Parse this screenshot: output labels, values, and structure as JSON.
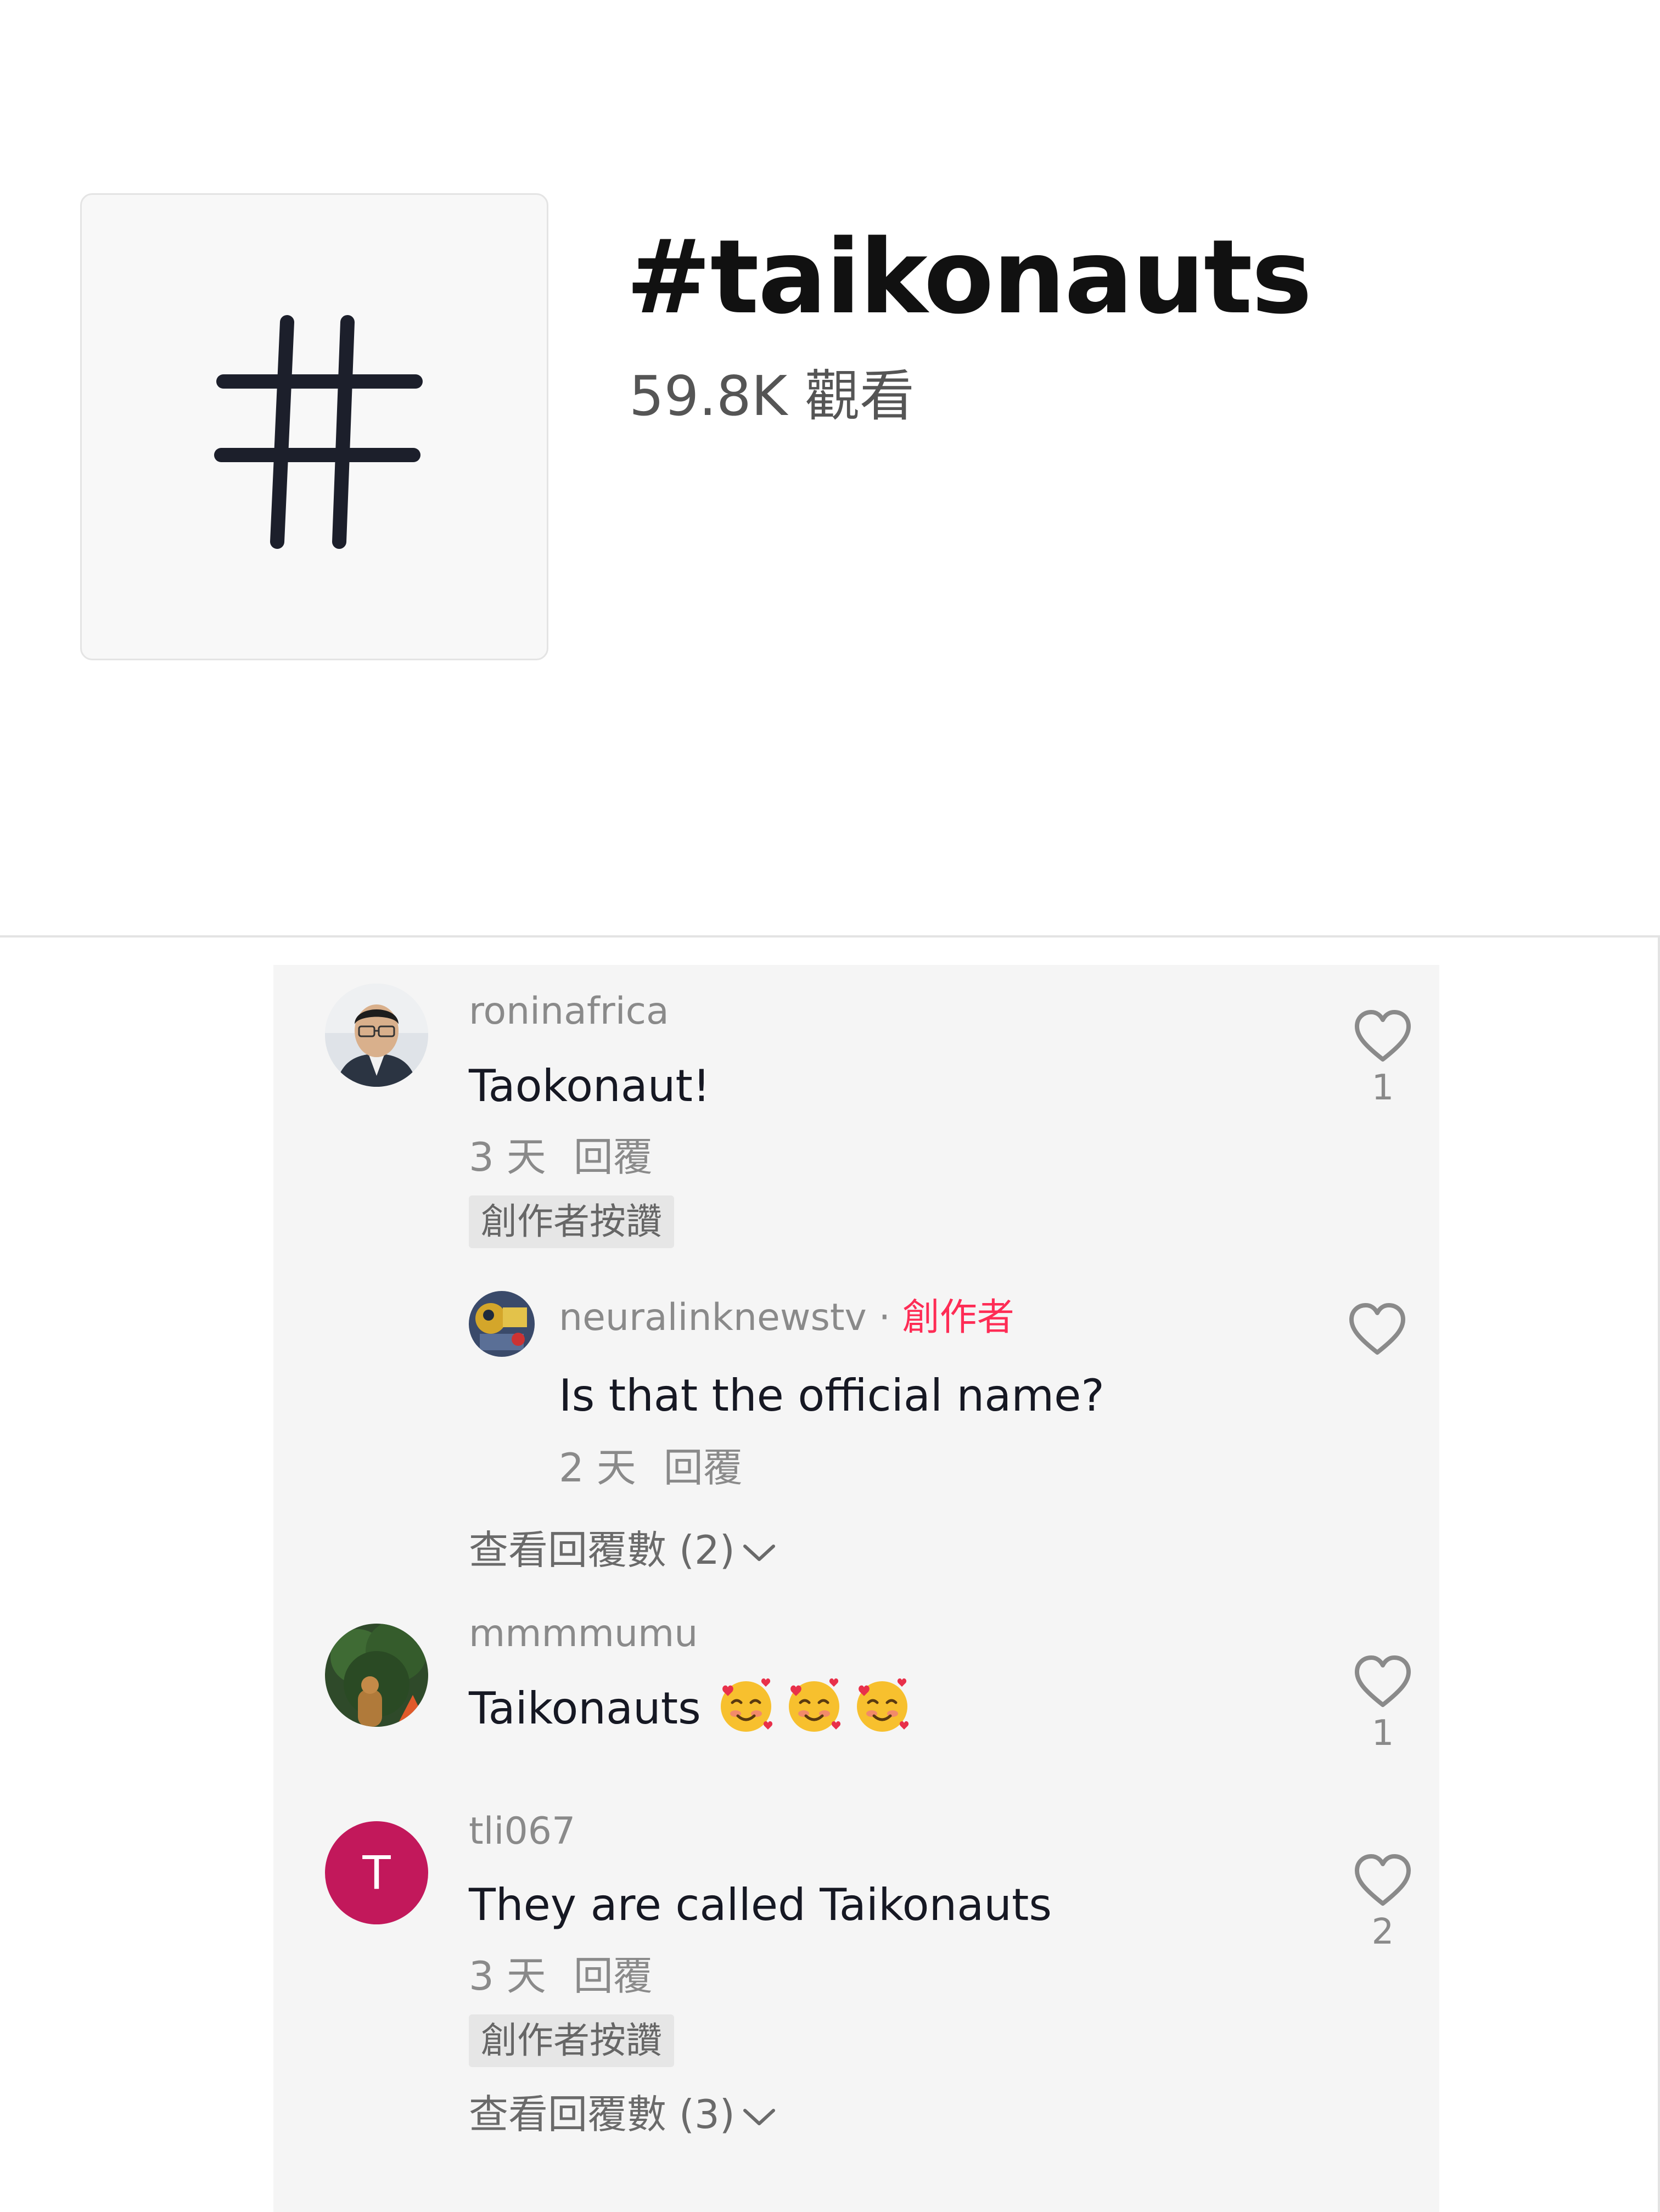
{
  "hashtag": {
    "title": "#taikonauts",
    "views": "59.8K 觀看"
  },
  "comments": [
    {
      "username": "roninafrica",
      "text": "Taokonaut!",
      "time": "3 天",
      "reply_label": "回覆",
      "badge": "創作者按讚",
      "likes": "1",
      "replies": [
        {
          "username": "neuralinknewstv",
          "separator": "·",
          "role": "創作者",
          "text": "Is that the official name?",
          "time": "2 天",
          "reply_label": "回覆"
        }
      ],
      "view_replies": "查看回覆數 (2)"
    },
    {
      "username": "mmmmumu",
      "text": "Taikonauts",
      "emoji": "smiling-face-with-hearts-emoji",
      "emoji_count": 3,
      "likes": "1"
    },
    {
      "username": "tli067",
      "avatar_letter": "T",
      "avatar_color": "#c2185b",
      "text": "They are called Taikonauts",
      "time": "3 天",
      "reply_label": "回覆",
      "badge": "創作者按讚",
      "likes": "2",
      "view_replies": "查看回覆數 (3)"
    }
  ],
  "colors": {
    "creator_accent": "#fe2c55",
    "panel_bg": "#f5f5f5",
    "muted_text": "#8a8a8a"
  }
}
